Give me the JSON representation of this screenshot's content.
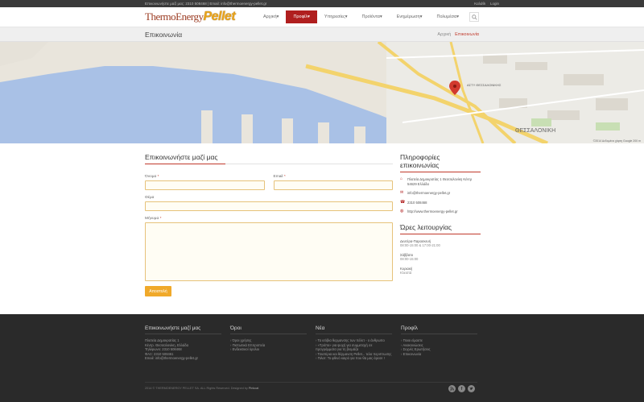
{
  "topbar": {
    "contact": "Επικοινωνήστε μαζί μας: 2310 508468 | Email: info@thermoenergy-pellet.gr",
    "cart": "Καλάθι",
    "login": "Login"
  },
  "logo": {
    "part1": "ThermoEnergy",
    "part2": "Pellet"
  },
  "nav": {
    "items": [
      {
        "label": "Αρχική"
      },
      {
        "label": "Προφίλ",
        "active": true
      },
      {
        "label": "Υπηρεσίες"
      },
      {
        "label": "Προϊόντα"
      },
      {
        "label": "Ενημέρωση"
      },
      {
        "label": "Πολυμέσα"
      }
    ],
    "search_icon": "search-icon"
  },
  "titlebar": {
    "title": "Επικοινωνία",
    "breadcrumb_home": "Αρχική",
    "breadcrumb_current": "Επικοινωνία"
  },
  "map": {
    "label_city": "ΘΕΣΣΑΛΟΝΙΚΗ",
    "label_area": "ΑΣΤΥ ΘΕΣΣΑΛΟΝΙΚΗΣ",
    "copyright": "©2014 Δεδομένα χάρτη Google  200 m"
  },
  "form": {
    "heading": "Επικοινωνήστε μαζί μας",
    "name_label": "Όνομα",
    "email_label": "Email",
    "subject_label": "Θέμα",
    "message_label": "Μήνυμα",
    "required_mark": "*",
    "submit": "Αποστολή"
  },
  "info": {
    "heading": "Πληροφορίες επικοινωνίας",
    "address": "Πλατεία Δημοκρατίας 1 Θεσσαλονίκη Κέντρ 54629 Ελλάδα",
    "email": "info@thermoenergy-pellet.gr",
    "phone": "2310 508468",
    "website": "http://www.thermoenergy-pellet.gr"
  },
  "hours": {
    "heading": "Ώρες λειτουργίας",
    "blocks": [
      {
        "day": "Δευτέρα-Παρασκευή",
        "time": "08:00-15:00 & 17:00-21:00"
      },
      {
        "day": "Σάββατο",
        "time": "08:00-15:00"
      },
      {
        "day": "Κυριακή",
        "time": "Κλειστά"
      }
    ]
  },
  "footer": {
    "col1": {
      "heading": "Επικοινωνήστε μαζί μας",
      "lines": [
        "Πλατεία Δημοκρατίας 1",
        "Κέντρ. Θεσσαλονίκη, Ελλάδα",
        "Τηλέφωνο: 2310 508468",
        "ΦΑΞ: 2310 508461",
        "Email: info@thermoenergy-pellet.gr"
      ]
    },
    "col2": {
      "heading": "Όροι",
      "links": [
        "Όροι χρήσης",
        "Πιστωτικά Επιτροπεία",
        "Ενδεικτικοί όρολοι"
      ]
    },
    "col3": {
      "heading": "Νέα",
      "links": [
        "Τα ισόβια θερμανσης των πέλετ - ο άνθρωπο",
        "«Τρόπο» για ψυχή για συμμετοχή σε προγράμματα για τη βιομάζα",
        "Τσιαπίρια και θέρμανση Pellet... τελα περιπτωσης",
        "Πιλοτ: Το φθινό καιρό για που θα μας άρεσε !"
      ]
    },
    "col4": {
      "heading": "Προφίλ",
      "links": [
        "Ποιοι είμαστε",
        "Ανακοινώσεις",
        "Συχνές Ερωτήσεις",
        "Επικοινωνία"
      ]
    },
    "copyright": "2014 © THERMOENERGY PELLET SA. ALL Rights Reserved. Designed by",
    "designer": "Pinkcat",
    "socials": [
      "rss-icon",
      "facebook-icon",
      "twitter-icon"
    ]
  }
}
